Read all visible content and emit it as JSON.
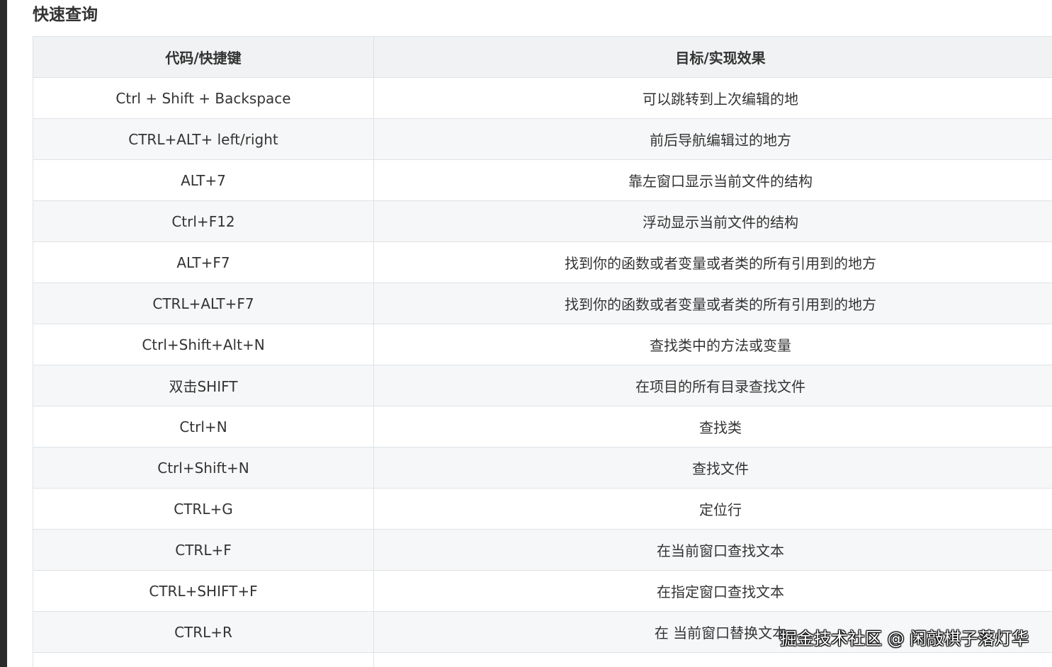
{
  "page": {
    "title": "快速查询"
  },
  "table": {
    "headers": [
      "代码/快捷键",
      "目标/实现效果"
    ],
    "rows": [
      [
        "Ctrl + Shift + Backspace",
        "可以跳转到上次编辑的地"
      ],
      [
        "CTRL+ALT+ left/right",
        "前后导航编辑过的地方"
      ],
      [
        "ALT+7",
        "靠左窗口显示当前文件的结构"
      ],
      [
        "Ctrl+F12",
        "浮动显示当前文件的结构"
      ],
      [
        "ALT+F7",
        "找到你的函数或者变量或者类的所有引用到的地方"
      ],
      [
        "CTRL+ALT+F7",
        "找到你的函数或者变量或者类的所有引用到的地方"
      ],
      [
        "Ctrl+Shift+Alt+N",
        "查找类中的方法或变量"
      ],
      [
        "双击SHIFT",
        "在项目的所有目录查找文件"
      ],
      [
        "Ctrl+N",
        "查找类"
      ],
      [
        "Ctrl+Shift+N",
        "查找文件"
      ],
      [
        "CTRL+G",
        "定位行"
      ],
      [
        "CTRL+F",
        "在当前窗口查找文本"
      ],
      [
        "CTRL+SHIFT+F",
        "在指定窗口查找文本"
      ],
      [
        "CTRL+R",
        "在 当前窗口替换文本"
      ],
      [
        "",
        ""
      ]
    ]
  },
  "watermark": {
    "text": "掘金技术社区 @ 闲敲棋子落灯华"
  },
  "colors": {
    "header_bg": "#f0f2f3",
    "row_alt_bg": "#f6f7f8",
    "border": "#dfe2e5",
    "text": "#333333"
  }
}
